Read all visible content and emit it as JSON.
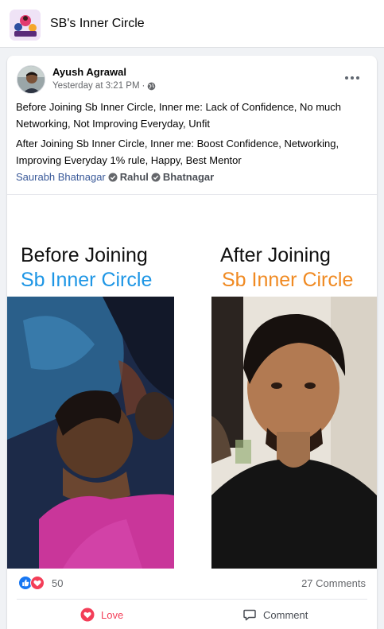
{
  "group": {
    "title": "SB's Inner Circle"
  },
  "post": {
    "author": "Ayush Agrawal",
    "timestamp": "Yesterday at 3:21 PM",
    "separator": "·",
    "audience_icon": "globe-icon",
    "paragraph_1": "Before Joining Sb Inner Circle, Inner me: Lack of Confidence, No much Networking, Not Improving Everyday, Unfit",
    "paragraph_2": "After Joining Sb Inner Circle, Inner me: Boost Confidence, Networking, Improving Everyday 1% rule, Happy, Best Mentor",
    "tags": {
      "tag_1": "Saurabh Bhatnagar",
      "tag_2": "Rahul",
      "tag_3": "Bhatnagar"
    },
    "image": {
      "before_title": "Before Joining",
      "before_subtitle": "Sb Inner Circle",
      "after_title": "After Joining",
      "after_subtitle": "Sb Inner Circle"
    },
    "reactions": {
      "icons": [
        "like-icon",
        "love-icon"
      ],
      "count": "50",
      "comments": "27 Comments"
    },
    "actions": {
      "love": "Love",
      "comment": "Comment"
    }
  },
  "colors": {
    "love": "#f33e58",
    "like": "#1877f2",
    "link": "#385898",
    "before_subtitle": "#1e96e5",
    "after_subtitle": "#f08a22"
  }
}
